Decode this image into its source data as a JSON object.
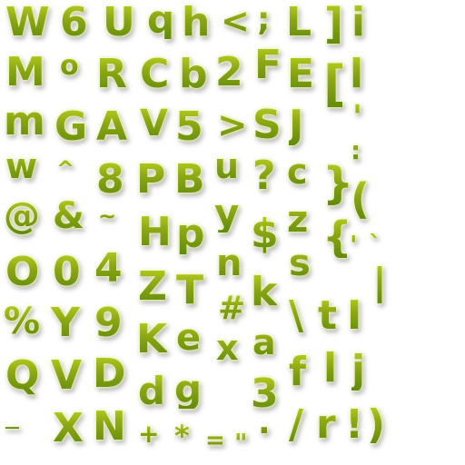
{
  "glyph_rows": [
    [
      "W",
      "6",
      "U",
      "q",
      "h",
      "<",
      ";",
      "L",
      "]",
      "i"
    ],
    [
      "M",
      "o",
      "R",
      "C",
      "b",
      "2",
      "F",
      "E",
      "[",
      "l"
    ],
    [
      "m",
      "G",
      "A",
      "V",
      "5",
      ">",
      "S",
      "J",
      "'"
    ],
    [
      "w",
      "^",
      "8",
      "P",
      "B",
      "u",
      "?",
      "c",
      "}",
      ":"
    ],
    [
      "@",
      "&",
      "~",
      "H",
      "p",
      "y",
      "$",
      "z",
      "{",
      "(",
      "'",
      "`"
    ],
    [
      "O",
      "0",
      "4",
      "Z",
      "T",
      "n",
      "k",
      "s",
      "|"
    ],
    [
      "%",
      "Y",
      "9",
      "K",
      "e",
      "#",
      "a",
      "\\",
      "t",
      "I"
    ],
    [
      "Q",
      "V",
      "D",
      "d",
      "g",
      "x",
      "3",
      "f",
      "l",
      "j"
    ],
    [
      "_",
      "X",
      "N",
      "+",
      "*",
      "=",
      "\"",
      ".",
      "/",
      "r",
      "!",
      ")"
    ]
  ],
  "colors": {
    "glyph_top": "#b8cf1e",
    "glyph_bottom": "#5f8a0a",
    "glow": "#f4f9c0",
    "background": "#ffffff"
  }
}
